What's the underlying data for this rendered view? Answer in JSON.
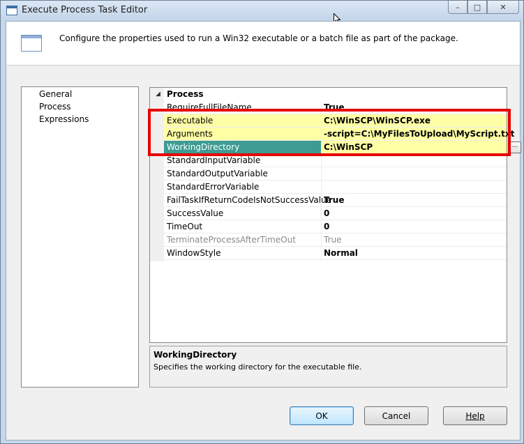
{
  "window": {
    "title": "Execute Process Task Editor",
    "caption_buttons": [
      "–",
      "□",
      "✕"
    ]
  },
  "header": {
    "description": "Configure the properties used to run a Win32 executable or a batch file as part of the package."
  },
  "nav": {
    "items": [
      "General",
      "Process",
      "Expressions"
    ],
    "selected": "Process"
  },
  "grid": {
    "group": "Process",
    "rows": [
      {
        "name": "RequireFullFileName",
        "value": "True"
      },
      {
        "name": "Executable",
        "value": "C:\\WinSCP\\WinSCP.exe"
      },
      {
        "name": "Arguments",
        "value": "-script=C:\\MyFilesToUpload\\MyScript.txt"
      },
      {
        "name": "WorkingDirectory",
        "value": "C:\\WinSCP"
      },
      {
        "name": "StandardInputVariable",
        "value": ""
      },
      {
        "name": "StandardOutputVariable",
        "value": ""
      },
      {
        "name": "StandardErrorVariable",
        "value": ""
      },
      {
        "name": "FailTaskIfReturnCodeIsNotSuccessValue",
        "value": "True"
      },
      {
        "name": "SuccessValue",
        "value": "0"
      },
      {
        "name": "TimeOut",
        "value": "0"
      },
      {
        "name": "TerminateProcessAfterTimeOut",
        "value": "True"
      },
      {
        "name": "WindowStyle",
        "value": "Normal"
      }
    ],
    "ellipsis_label": "..."
  },
  "description_panel": {
    "title": "WorkingDirectory",
    "text": "Specifies the working directory for the executable file."
  },
  "buttons": {
    "ok": "OK",
    "cancel": "Cancel",
    "help": "Help"
  },
  "colors": {
    "highlight_rows": "#ffffa6",
    "selected_row": "#3d9b94",
    "annotation_box": "#e60000"
  }
}
